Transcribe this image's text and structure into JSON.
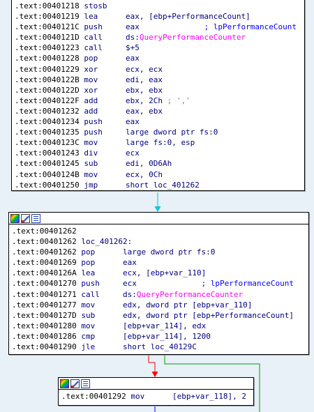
{
  "colors": {
    "background": "#e8f0f8",
    "edge_true": "#00a000",
    "edge_false": "#ff0000",
    "edge_unconditional": "#00c8e0",
    "edge_other": "#0000ff",
    "import_name": "#ff00ff"
  },
  "toolbar_icons": [
    "graph-overview-icon",
    "edit-node-icon",
    "text-view-icon"
  ],
  "blocks": [
    {
      "id": "block-top",
      "has_toolbar": false,
      "lines": [
        {
          "addr": ".text:00401218",
          "mn": "stosb",
          "ops": []
        },
        {
          "addr": ".text:00401219",
          "mn": "lea",
          "ops": [
            {
              "t": "eax, [ebp+",
              "c": "opd"
            },
            {
              "t": "PerformanceCount",
              "c": "var"
            },
            {
              "t": "]",
              "c": "opd"
            }
          ]
        },
        {
          "addr": ".text:0040121C",
          "mn": "push",
          "ops": [
            {
              "t": "eax",
              "c": "opd"
            },
            {
              "t": "              ; lpPerformanceCount",
              "c": "cmt"
            }
          ]
        },
        {
          "addr": ".text:0040121D",
          "mn": "call",
          "ops": [
            {
              "t": "ds:",
              "c": "opd"
            },
            {
              "t": "QueryPerformanceCounter",
              "c": "pink"
            }
          ]
        },
        {
          "addr": ".text:00401223",
          "mn": "call",
          "ops": [
            {
              "t": "$+5",
              "c": "opd"
            }
          ]
        },
        {
          "addr": ".text:00401228",
          "mn": "pop",
          "ops": [
            {
              "t": "eax",
              "c": "opd"
            }
          ]
        },
        {
          "addr": ".text:00401229",
          "mn": "xor",
          "ops": [
            {
              "t": "ecx, ecx",
              "c": "opd"
            }
          ]
        },
        {
          "addr": ".text:0040122B",
          "mn": "mov",
          "ops": [
            {
              "t": "edi, eax",
              "c": "opd"
            }
          ]
        },
        {
          "addr": ".text:0040122D",
          "mn": "xor",
          "ops": [
            {
              "t": "ebx, ebx",
              "c": "opd"
            }
          ]
        },
        {
          "addr": ".text:0040122F",
          "mn": "add",
          "ops": [
            {
              "t": "ebx, 2Ch",
              "c": "opd"
            },
            {
              "t": " ; ','",
              "c": "gray"
            }
          ]
        },
        {
          "addr": ".text:00401232",
          "mn": "add",
          "ops": [
            {
              "t": "eax, ebx",
              "c": "opd"
            }
          ]
        },
        {
          "addr": ".text:00401234",
          "mn": "push",
          "ops": [
            {
              "t": "eax",
              "c": "opd"
            }
          ]
        },
        {
          "addr": ".text:00401235",
          "mn": "push",
          "ops": [
            {
              "t": "large dword ptr fs:0",
              "c": "opd"
            }
          ]
        },
        {
          "addr": ".text:0040123C",
          "mn": "mov",
          "ops": [
            {
              "t": "large fs:0, esp",
              "c": "opd"
            }
          ]
        },
        {
          "addr": ".text:00401243",
          "mn": "div",
          "ops": [
            {
              "t": "ecx",
              "c": "opd"
            }
          ]
        },
        {
          "addr": ".text:00401245",
          "mn": "sub",
          "ops": [
            {
              "t": "edi, 0D6Ah",
              "c": "opd"
            }
          ]
        },
        {
          "addr": ".text:0040124B",
          "mn": "mov",
          "ops": [
            {
              "t": "ecx, 0Ch",
              "c": "opd"
            }
          ]
        },
        {
          "addr": ".text:00401250",
          "mn": "jmp",
          "ops": [
            {
              "t": "short loc_401262",
              "c": "opd"
            }
          ]
        }
      ]
    },
    {
      "id": "block-loc_401262",
      "has_toolbar": true,
      "lines": [
        {
          "addr": ".text:00401262",
          "mn": "",
          "ops": []
        },
        {
          "addr": ".text:00401262",
          "label": "loc_401262:",
          "mn": "",
          "ops": []
        },
        {
          "addr": ".text:00401262",
          "mn": "pop",
          "ops": [
            {
              "t": "large dword ptr fs:0",
              "c": "opd"
            }
          ]
        },
        {
          "addr": ".text:00401269",
          "mn": "pop",
          "ops": [
            {
              "t": "eax",
              "c": "opd"
            }
          ]
        },
        {
          "addr": ".text:0040126A",
          "mn": "lea",
          "ops": [
            {
              "t": "ecx, [ebp+",
              "c": "opd"
            },
            {
              "t": "var_110",
              "c": "var"
            },
            {
              "t": "]",
              "c": "opd"
            }
          ]
        },
        {
          "addr": ".text:00401270",
          "mn": "push",
          "ops": [
            {
              "t": "ecx",
              "c": "opd"
            },
            {
              "t": "              ; lpPerformanceCount",
              "c": "cmt"
            }
          ]
        },
        {
          "addr": ".text:00401271",
          "mn": "call",
          "ops": [
            {
              "t": "ds:",
              "c": "opd"
            },
            {
              "t": "QueryPerformanceCounter",
              "c": "pink"
            }
          ]
        },
        {
          "addr": ".text:00401277",
          "mn": "mov",
          "ops": [
            {
              "t": "edx, dword ptr [ebp+",
              "c": "opd"
            },
            {
              "t": "var_110",
              "c": "var"
            },
            {
              "t": "]",
              "c": "opd"
            }
          ]
        },
        {
          "addr": ".text:0040127D",
          "mn": "sub",
          "ops": [
            {
              "t": "edx, dword ptr [ebp+",
              "c": "opd"
            },
            {
              "t": "PerformanceCount",
              "c": "var"
            },
            {
              "t": "]",
              "c": "opd"
            }
          ]
        },
        {
          "addr": ".text:00401280",
          "mn": "mov",
          "ops": [
            {
              "t": "[ebp+",
              "c": "opd"
            },
            {
              "t": "var_114",
              "c": "var"
            },
            {
              "t": "], edx",
              "c": "opd"
            }
          ]
        },
        {
          "addr": ".text:00401286",
          "mn": "cmp",
          "ops": [
            {
              "t": "[ebp+",
              "c": "opd"
            },
            {
              "t": "var_114",
              "c": "var"
            },
            {
              "t": "], 1200",
              "c": "opd"
            }
          ]
        },
        {
          "addr": ".text:00401290",
          "mn": "jle",
          "ops": [
            {
              "t": "short loc_40129C",
              "c": "opd"
            }
          ]
        }
      ]
    },
    {
      "id": "block-00401292",
      "has_toolbar": true,
      "lines": [
        {
          "addr": ".text:00401292",
          "mn": "mov",
          "ops": [
            {
              "t": "[ebp+",
              "c": "opd"
            },
            {
              "t": "var_118",
              "c": "var"
            },
            {
              "t": "], 2",
              "c": "opd"
            }
          ]
        }
      ]
    }
  ]
}
